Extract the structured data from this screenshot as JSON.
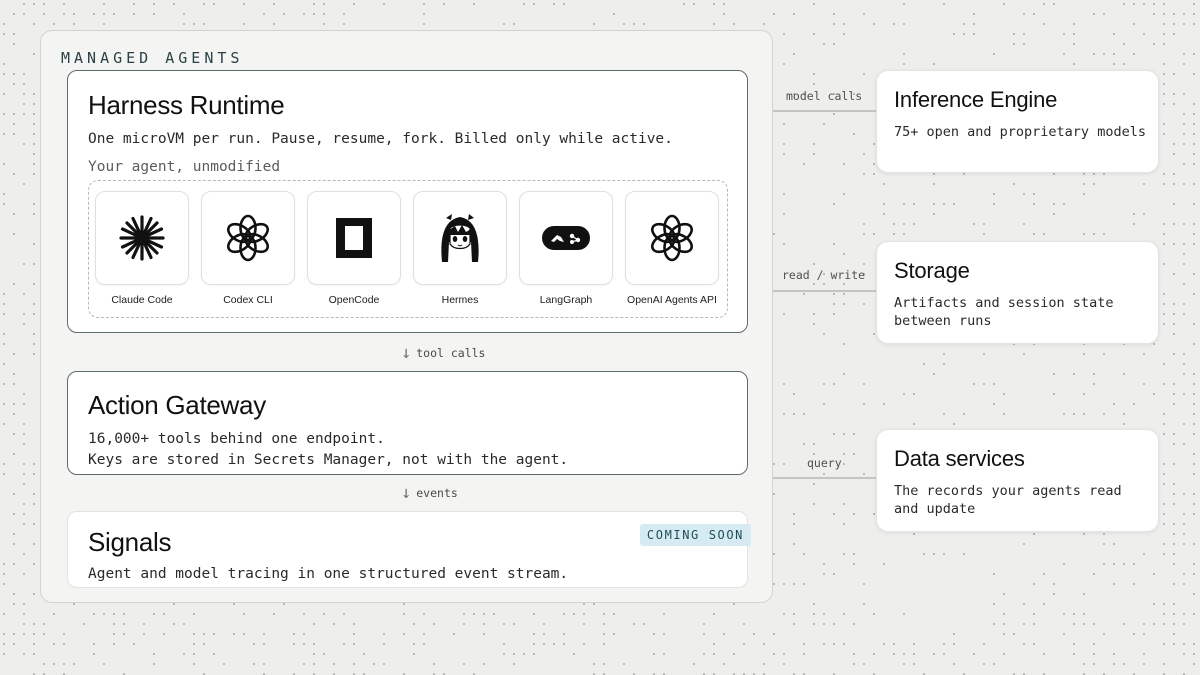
{
  "managed_agents": {
    "title": "MANAGED AGENTS",
    "harness": {
      "title": "Harness Runtime",
      "description": "One microVM per run. Pause, resume, fork. Billed only while active.",
      "agents_label": "Your agent, unmodified",
      "agents": [
        {
          "label": "Claude Code",
          "icon": "claude-starburst-icon"
        },
        {
          "label": "Codex CLI",
          "icon": "openai-knot-icon"
        },
        {
          "label": "OpenCode",
          "icon": "opencode-square-icon"
        },
        {
          "label": "Hermes",
          "icon": "hermes-anime-girl-icon"
        },
        {
          "label": "LangGraph",
          "icon": "langgraph-pill-icon"
        },
        {
          "label": "OpenAI Agents API",
          "icon": "openai-knot-icon"
        }
      ]
    },
    "arrow_tool_calls": "tool calls",
    "gateway": {
      "title": "Action Gateway",
      "description": "16,000+ tools behind one endpoint.\nKeys are stored in Secrets Manager, not with the agent."
    },
    "arrow_events": "events",
    "signals": {
      "title": "Signals",
      "badge": "COMING SOON",
      "description": "Agent and model tracing in one structured event stream."
    }
  },
  "services": [
    {
      "connector_label": "model calls",
      "title": "Inference Engine",
      "description": "75+ open and proprietary models"
    },
    {
      "connector_label": "read / write",
      "title": "Storage",
      "description": "Artifacts and session state between runs"
    },
    {
      "connector_label": "query",
      "title": "Data services",
      "description": "The records your agents read and update"
    }
  ],
  "colors": {
    "background": "#eeeeec",
    "card_border": "#5d6b6c",
    "badge_bg": "#d6ebf1",
    "badge_text": "#1e4d57",
    "title_accent": "#2a4347"
  }
}
